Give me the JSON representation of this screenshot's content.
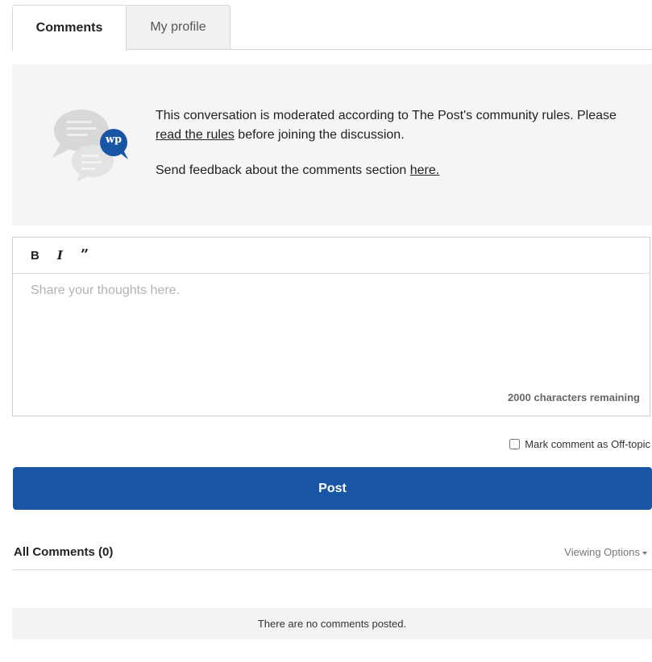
{
  "tabs": [
    {
      "label": "Comments",
      "active": true
    },
    {
      "label": "My profile",
      "active": false
    }
  ],
  "notice": {
    "line1_before": "This conversation is moderated according to The Post's community rules. Please ",
    "line1_link": "read the rules",
    "line1_after": " before joining the discussion.",
    "line2_before": "Send feedback about the comments section ",
    "line2_link": "here.",
    "logo_text": "wp"
  },
  "editor": {
    "toolbar": {
      "bold": "B",
      "italic": "I",
      "quote": "”"
    },
    "placeholder": "Share your thoughts here.",
    "value": "",
    "char_count": "2000 characters remaining"
  },
  "offtopic_label": "Mark comment as Off-topic",
  "post_label": "Post",
  "comments": {
    "title": "All Comments (0)",
    "viewing_options": "Viewing Options",
    "empty_message": "There are no comments posted."
  },
  "colors": {
    "accent": "#1955a5",
    "panel": "#f5f5f5"
  }
}
